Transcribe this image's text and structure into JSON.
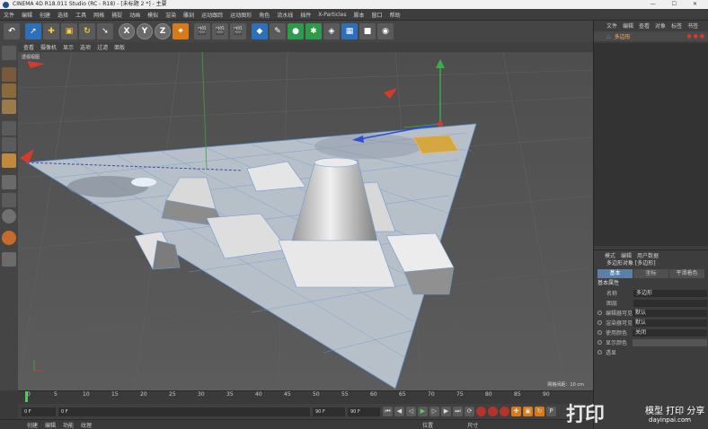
{
  "title": "CINEMA 4D R18.011 Studio (RC - R18) - [未标题 2 *] - 主要",
  "window_buttons": "— ☐ ✕",
  "menu": [
    "文件",
    "编辑",
    "创建",
    "选择",
    "工具",
    "网格",
    "捕捉",
    "动画",
    "模拟",
    "渲染",
    "雕刻",
    "运动跟踪",
    "运动图形",
    "角色",
    "流水线",
    "插件",
    "X-Particles",
    "脚本",
    "窗口",
    "帮助"
  ],
  "toolbar": {
    "undo": "↶",
    "x": "X",
    "y": "Y",
    "z": "Z"
  },
  "viewport_menu": [
    "查看",
    "摄像机",
    "显示",
    "选项",
    "过滤",
    "面板"
  ],
  "viewport_label": "透视视图",
  "grid_distance": "网格间距：10 cm",
  "timeline_ticks": [
    "0",
    "5",
    "10",
    "15",
    "20",
    "25",
    "30",
    "35",
    "40",
    "45",
    "50",
    "55",
    "60",
    "65",
    "70",
    "75",
    "80",
    "85",
    "90"
  ],
  "playback": {
    "current": "0 F",
    "start": "0 F",
    "end": "90 F",
    "end2": "90 F",
    "preview_end": "0 F"
  },
  "bottom_menu": [
    "创建",
    "编辑",
    "功能",
    "纹理"
  ],
  "bottom_right": [
    "位置",
    "尺寸"
  ],
  "object_manager": {
    "menu": [
      "文件",
      "编辑",
      "查看",
      "对象",
      "标签",
      "书签"
    ],
    "object_name": "多边形"
  },
  "attribute_manager": {
    "menu": [
      "模式",
      "编辑",
      "用户数据"
    ],
    "title": "多边形对象 [多边形]",
    "tabs": [
      "基本",
      "坐标",
      "平滑着色"
    ],
    "section": "基本属性",
    "props": [
      {
        "label": "名称",
        "value": "多边形"
      },
      {
        "label": "图层",
        "value": ""
      },
      {
        "label": "编辑器可见",
        "value": "默认"
      },
      {
        "label": "渲染器可见",
        "value": "默认"
      },
      {
        "label": "使用颜色",
        "value": "关闭"
      },
      {
        "label": "显示颜色",
        "value": ""
      },
      {
        "label": "透显",
        "value": ""
      }
    ]
  },
  "watermark": {
    "logo": "打印",
    "text": "模型 打印 分享",
    "url": "dayinpai.com"
  }
}
